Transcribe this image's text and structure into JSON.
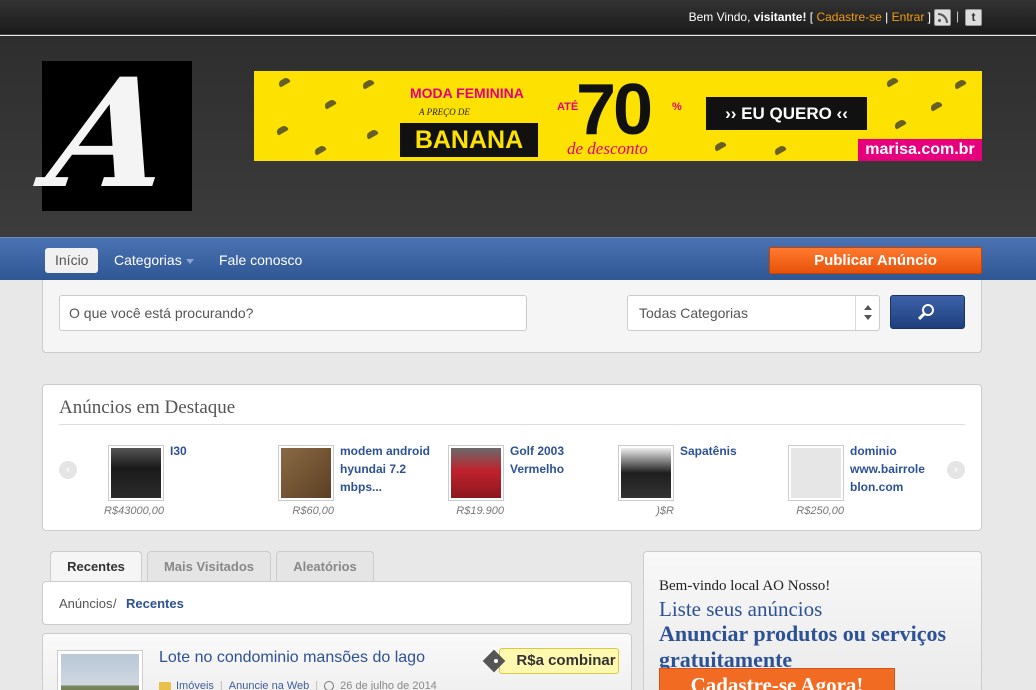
{
  "topbar": {
    "welcome_prefix": "Bem Vindo, ",
    "user": "visitante!",
    "bracket_open": " [ ",
    "register": "Cadastre-se",
    "divider": " | ",
    "login": "Entrar",
    "bracket_close": " ]",
    "pipe": "|",
    "twitter": "t"
  },
  "logo": {
    "letter": "A"
  },
  "banner": {
    "line1": "MODA FEMININA",
    "line2": "A PREÇO DE",
    "line3": "BANANA",
    "ate": "ATÉ",
    "percent": "70",
    "percent_sign": "%",
    "desconto": "de desconto",
    "cta": "›› EU QUERO ‹‹",
    "brand": "marisa.com.br"
  },
  "nav": {
    "items": [
      {
        "label": "Início"
      },
      {
        "label": "Categorias"
      },
      {
        "label": "Fale conosco"
      }
    ],
    "publish": "Publicar Anúncio"
  },
  "search": {
    "placeholder": "O que você está procurando?",
    "category": "Todas Categorias"
  },
  "featured": {
    "title": "Anúncios em Destaque",
    "prev": "‹",
    "next": "›",
    "items": [
      {
        "name": "I30",
        "price": "R$43000,00",
        "thumb": "#1a1a1a"
      },
      {
        "name": "modem android hyundai 7.2 mbps...",
        "price": "R$60,00",
        "thumb": "#6b4a2a"
      },
      {
        "name": "Golf 2003 Vermelho",
        "price": "R$19.900",
        "thumb": "#b0202a"
      },
      {
        "name": "Sapatênis",
        "price": "R$(",
        "thumb": "#2a2a2a"
      },
      {
        "name": "dominio www.bairrole blon.com",
        "price": "R$250,00",
        "thumb": "#e3e3e3"
      }
    ]
  },
  "tabs": [
    {
      "label": "Recentes"
    },
    {
      "label": "Mais Visitados"
    },
    {
      "label": "Aleatórios"
    }
  ],
  "breadcrumb": {
    "root": "Anúncios",
    "sep": " / ",
    "current": "Recentes"
  },
  "listing": {
    "title": "Lote no condominio mansões do lago",
    "price": "R$a combinar",
    "category": "Imóveis",
    "source": "Anuncie na Web",
    "date": "26 de julho de 2014"
  },
  "widget": {
    "greeting": "Bem-vindo local AO Nosso!",
    "line2": "Liste seus anúncios",
    "line3": "Anunciar produtos ou serviços gratuitamente",
    "cta": "Cadastre-se Agora!"
  },
  "colors": {
    "accent": "#f26b22",
    "nav": "#3a62a3",
    "link": "#2d5195"
  }
}
